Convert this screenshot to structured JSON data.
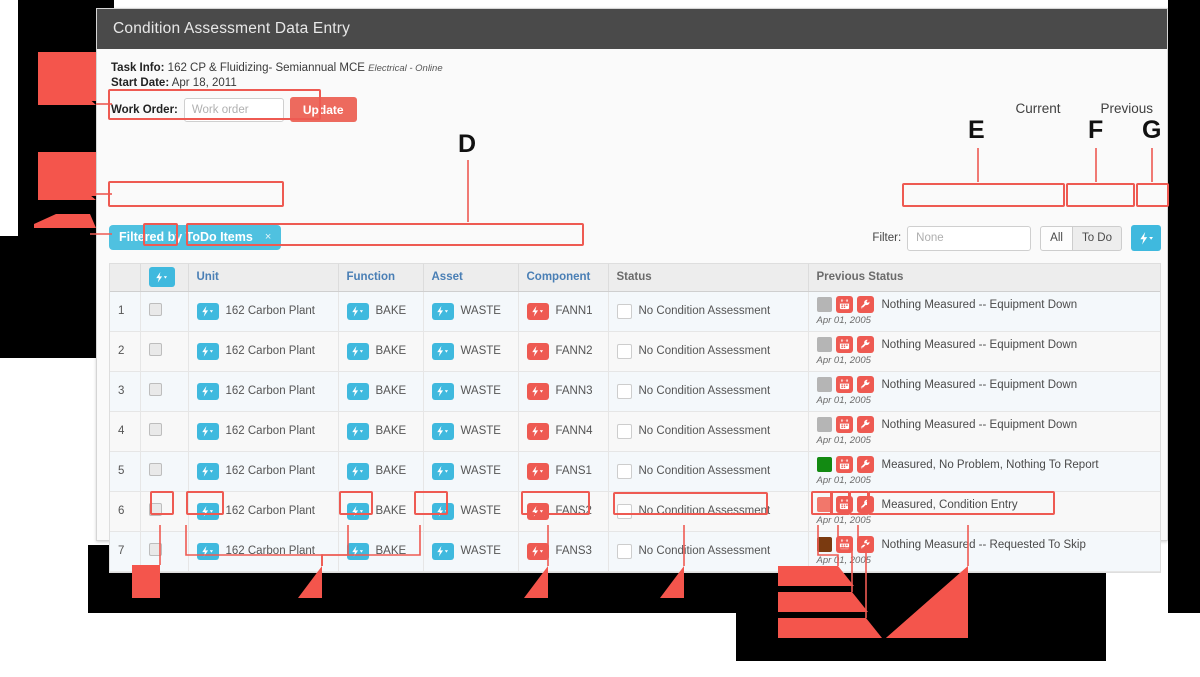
{
  "window": {
    "title": "Condition Assessment Data Entry"
  },
  "task": {
    "task_info_label": "Task Info:",
    "task_info_value": "162 CP & Fluidizing- Semiannual MCE",
    "task_info_emphasis": "Electrical - Online",
    "start_date_label": "Start Date:",
    "start_date_value": "Apr 18, 2011",
    "work_order_label": "Work Order:",
    "work_order_value": "",
    "work_order_placeholder": "Work order",
    "update_label": "Update"
  },
  "topnav": {
    "current": "Current",
    "previous": "Previous"
  },
  "filter_badge": {
    "label": "Filtered by ToDo Items",
    "close": "×"
  },
  "filterbar": {
    "label": "Filter:",
    "value": "",
    "placeholder": "None",
    "all_label": "All",
    "todo_label": "To Do",
    "todo_active": true,
    "bolt_icon": "bolt-dropdown-icon"
  },
  "table": {
    "header_bolt_icon": "bolt-dropdown-icon",
    "columns": [
      {
        "key": "num",
        "label": "",
        "link": false
      },
      {
        "key": "chk",
        "label": "",
        "link": false
      },
      {
        "key": "unit",
        "label": "Unit",
        "link": true
      },
      {
        "key": "func",
        "label": "Function",
        "link": true
      },
      {
        "key": "asset",
        "label": "Asset",
        "link": true
      },
      {
        "key": "comp",
        "label": "Component",
        "link": true
      },
      {
        "key": "status",
        "label": "Status",
        "link": false
      },
      {
        "key": "prev",
        "label": "Previous Status",
        "link": false
      }
    ],
    "rows": [
      {
        "num": "1",
        "unit": "162 Carbon Plant",
        "func": "BAKE",
        "asset": "WASTE",
        "comp": "FANN1",
        "status": "No Condition Assessment",
        "status_color": "#ffffff",
        "prev_color": "#b5b5b5",
        "prev": "Nothing Measured -- Equipment Down",
        "prev_date": "Apr 01, 2005"
      },
      {
        "num": "2",
        "unit": "162 Carbon Plant",
        "func": "BAKE",
        "asset": "WASTE",
        "comp": "FANN2",
        "status": "No Condition Assessment",
        "status_color": "#ffffff",
        "prev_color": "#b5b5b5",
        "prev": "Nothing Measured -- Equipment Down",
        "prev_date": "Apr 01, 2005"
      },
      {
        "num": "3",
        "unit": "162 Carbon Plant",
        "func": "BAKE",
        "asset": "WASTE",
        "comp": "FANN3",
        "status": "No Condition Assessment",
        "status_color": "#ffffff",
        "prev_color": "#b5b5b5",
        "prev": "Nothing Measured -- Equipment Down",
        "prev_date": "Apr 01, 2005"
      },
      {
        "num": "4",
        "unit": "162 Carbon Plant",
        "func": "BAKE",
        "asset": "WASTE",
        "comp": "FANN4",
        "status": "No Condition Assessment",
        "status_color": "#ffffff",
        "prev_color": "#b5b5b5",
        "prev": "Nothing Measured -- Equipment Down",
        "prev_date": "Apr 01, 2005"
      },
      {
        "num": "5",
        "unit": "162 Carbon Plant",
        "func": "BAKE",
        "asset": "WASTE",
        "comp": "FANS1",
        "status": "No Condition Assessment",
        "status_color": "#ffffff",
        "prev_color": "#128a12",
        "prev": "Measured, No Problem, Nothing To Report",
        "prev_date": "Apr 01, 2005"
      },
      {
        "num": "6",
        "unit": "162 Carbon Plant",
        "func": "BAKE",
        "asset": "WASTE",
        "comp": "FANS2",
        "status": "No Condition Assessment",
        "status_color": "#ffffff",
        "prev_color": "#f2776b",
        "prev": "Measured, Condition Entry",
        "prev_date": "Apr 01, 2005"
      },
      {
        "num": "7",
        "unit": "162 Carbon Plant",
        "func": "BAKE",
        "asset": "WASTE",
        "comp": "FANS3",
        "status": "No Condition Assessment",
        "status_color": "#ffffff",
        "prev_color": "#7a3a10",
        "prev": "Nothing Measured -- Requested To Skip",
        "prev_date": "Apr 01, 2005"
      }
    ]
  },
  "annotations": {
    "letters": [
      {
        "id": "D",
        "label": "D"
      },
      {
        "id": "E",
        "label": "E"
      },
      {
        "id": "F",
        "label": "F"
      },
      {
        "id": "G",
        "label": "G"
      }
    ],
    "accent_color": "#ee5a52"
  }
}
